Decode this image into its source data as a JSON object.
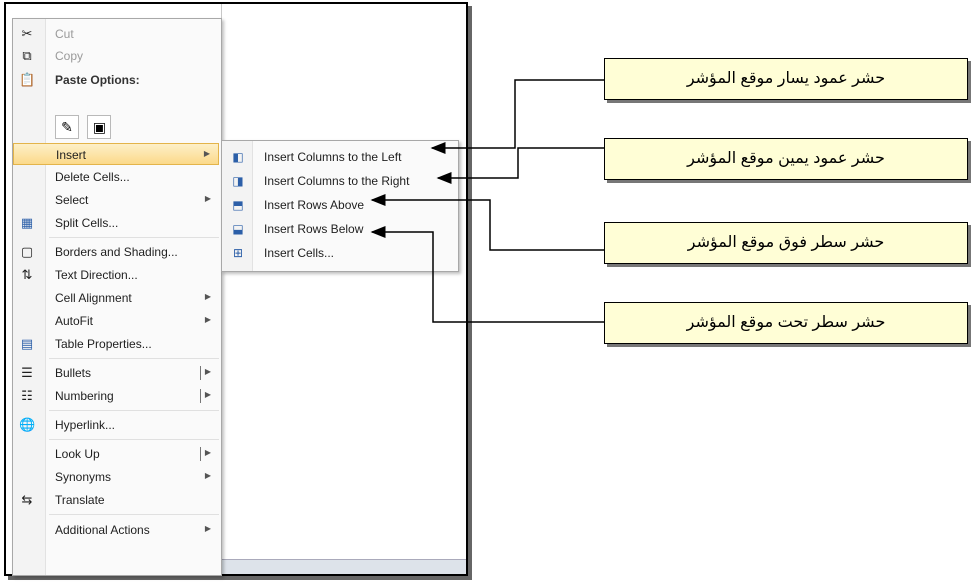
{
  "menu": {
    "cut": "Cut",
    "copy": "Copy",
    "paste_header": "Paste Options:",
    "insert": "Insert",
    "delete_cells": "Delete Cells...",
    "select": "Select",
    "split_cells": "Split Cells...",
    "borders": "Borders and Shading...",
    "text_direction": "Text Direction...",
    "cell_alignment": "Cell Alignment",
    "autofit": "AutoFit",
    "table_properties": "Table Properties...",
    "bullets": "Bullets",
    "numbering": "Numbering",
    "hyperlink": "Hyperlink...",
    "look_up": "Look Up",
    "synonyms": "Synonyms",
    "translate": "Translate",
    "additional_actions": "Additional Actions"
  },
  "submenu": {
    "cols_left": "Insert Columns to the Left",
    "cols_right": "Insert Columns to the Right",
    "rows_above": "Insert Rows Above",
    "rows_below": "Insert Rows Below",
    "insert_cells": "Insert Cells..."
  },
  "callouts": {
    "left": "حشر عمود يسار موقع المؤشر",
    "right": "حشر عمود يمين موقع المؤشر",
    "above": "حشر سطر فوق موقع المؤشر",
    "below": "حشر سطر تحت موقع المؤشر"
  },
  "icons": {
    "cut": "scissors-icon",
    "copy": "copy-icon",
    "paste": "clipboard-icon",
    "split": "table-grid-icon",
    "borders": "borders-icon",
    "text_dir": "text-direction-icon",
    "table_props": "table-properties-icon",
    "bullets": "bullets-icon",
    "numbering": "numbering-icon",
    "hyperlink": "hyperlink-icon",
    "translate": "translate-icon"
  },
  "colors": {
    "highlight": "#fbd98a",
    "callout_bg": "#fffed6"
  }
}
